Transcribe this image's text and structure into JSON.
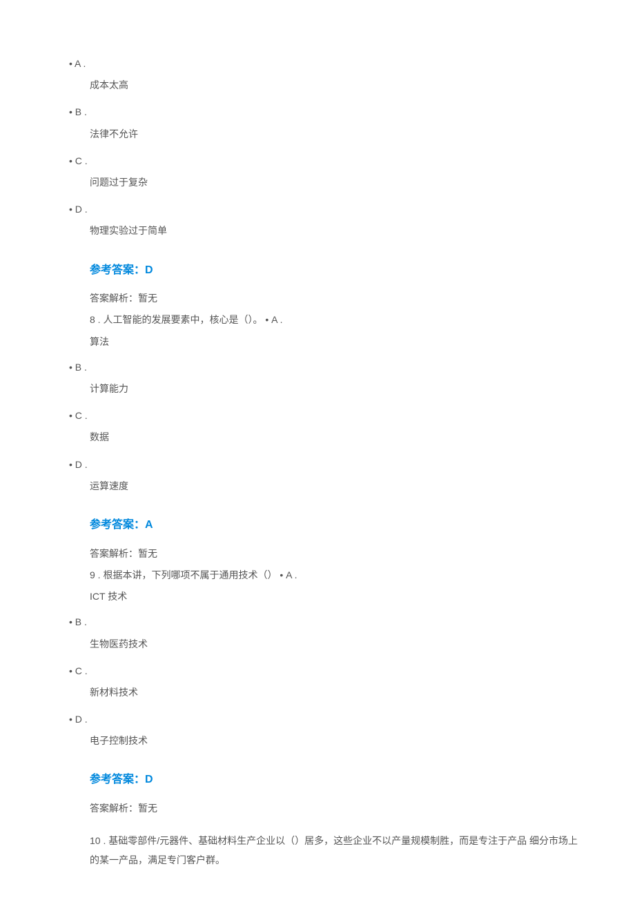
{
  "q7": {
    "options": [
      {
        "label": "• A .",
        "text": "成本太高"
      },
      {
        "label": "• B .",
        "text": "法律不允许"
      },
      {
        "label": "• C .",
        "text": "问题过于复杂"
      },
      {
        "label": "• D .",
        "text": "物理实验过于简单"
      }
    ],
    "answer_title": "参考答案：D",
    "analysis": "答案解析：暂无"
  },
  "q8": {
    "number": "8  .",
    "stem": "  人工智能的发展要素中，核心是（）。  • A .",
    "inline_first_option": "算法",
    "options": [
      {
        "label": "• B .",
        "text": "计算能力"
      },
      {
        "label": "• C .",
        "text": "数据"
      },
      {
        "label": "• D .",
        "text": "运算速度"
      }
    ],
    "answer_title": "参考答案：A",
    "analysis": "答案解析：暂无"
  },
  "q9": {
    "number": "9  .",
    "stem": "  根据本讲，下列哪项不属于通用技术（）  • A .",
    "inline_first_option": "ICT 技术",
    "options": [
      {
        "label": "• B .",
        "text": "生物医药技术"
      },
      {
        "label": "• C .",
        "text": "新材料技术"
      },
      {
        "label": "• D .",
        "text": "电子控制技术"
      }
    ],
    "answer_title": "参考答案：D",
    "analysis": "答案解析：暂无"
  },
  "q10": {
    "number": "10  .",
    "stem": "  基础零部件/元器件、基础材料生产企业以（）居多，这些企业不以产量规模制胜，而是专注于产品 细分市场上的某一产品，满足专门客户群。"
  }
}
